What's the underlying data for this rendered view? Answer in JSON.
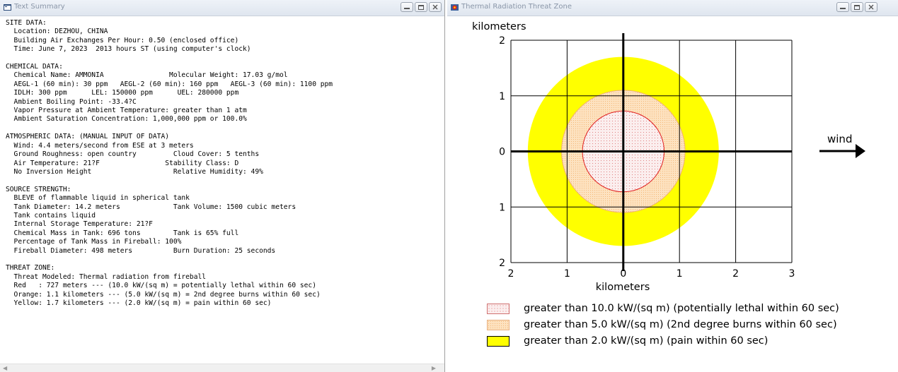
{
  "left_window": {
    "title": "Text Summary",
    "lines": [
      "SITE DATA:",
      "  Location: DEZHOU, CHINA",
      "  Building Air Exchanges Per Hour: 0.50 (enclosed office)",
      "  Time: June 7, 2023  2013 hours ST (using computer's clock)",
      "",
      "CHEMICAL DATA:",
      "  Chemical Name: AMMONIA                Molecular Weight: 17.03 g/mol",
      "  AEGL-1 (60 min): 30 ppm   AEGL-2 (60 min): 160 ppm   AEGL-3 (60 min): 1100 ppm",
      "  IDLH: 300 ppm      LEL: 150000 ppm      UEL: 280000 ppm",
      "  Ambient Boiling Point: -33.4?C",
      "  Vapor Pressure at Ambient Temperature: greater than 1 atm",
      "  Ambient Saturation Concentration: 1,000,000 ppm or 100.0%",
      "",
      "ATMOSPHERIC DATA: (MANUAL INPUT OF DATA)",
      "  Wind: 4.4 meters/second from ESE at 3 meters",
      "  Ground Roughness: open country         Cloud Cover: 5 tenths",
      "  Air Temperature: 21?F                Stability Class: D",
      "  No Inversion Height                    Relative Humidity: 49%",
      "",
      "SOURCE STRENGTH:",
      "  BLEVE of flammable liquid in spherical tank",
      "  Tank Diameter: 14.2 meters             Tank Volume: 1500 cubic meters",
      "  Tank contains liquid",
      "  Internal Storage Temperature: 21?F",
      "  Chemical Mass in Tank: 696 tons        Tank is 65% full",
      "  Percentage of Tank Mass in Fireball: 100%",
      "  Fireball Diameter: 498 meters          Burn Duration: 25 seconds",
      "",
      "THREAT ZONE:",
      "  Threat Modeled: Thermal radiation from fireball",
      "  Red   : 727 meters --- (10.0 kW/(sq m) = potentially lethal within 60 sec)",
      "  Orange: 1.1 kilometers --- (5.0 kW/(sq m) = 2nd degree burns within 60 sec)",
      "  Yellow: 1.7 kilometers --- (2.0 kW/(sq m) = pain within 60 sec)"
    ]
  },
  "right_window": {
    "title": "Thermal Radiation Threat Zone",
    "wind_label": "wind",
    "legend": [
      {
        "label": "greater than 10.0 kW/(sq m) (potentially lethal within 60 sec)",
        "color": "#f6dede"
      },
      {
        "label": "greater than 5.0 kW/(sq m) (2nd degree burns within 60 sec)",
        "color": "#fbd7a8"
      },
      {
        "label": "greater than 2.0 kW/(sq m) (pain within 60 sec)",
        "color": "#ffff00"
      }
    ]
  },
  "chart_data": {
    "type": "threat-zone-plot",
    "ylabel": "kilometers",
    "xlabel": "kilometers",
    "xlim": [
      -2,
      3
    ],
    "ylim": [
      -2,
      2
    ],
    "x_tick_labels": [
      "2",
      "1",
      "0",
      "1",
      "2",
      "3"
    ],
    "y_tick_labels": [
      "2",
      "1",
      "0",
      "1",
      "2"
    ],
    "grid": true,
    "zones": [
      {
        "name": "Yellow",
        "radius_km": 1.7,
        "color": "#ffff00"
      },
      {
        "name": "Orange",
        "radius_km": 1.1,
        "color": "#fbd7a8"
      },
      {
        "name": "Red",
        "radius_km": 0.727,
        "color": "#f6dede"
      }
    ]
  }
}
